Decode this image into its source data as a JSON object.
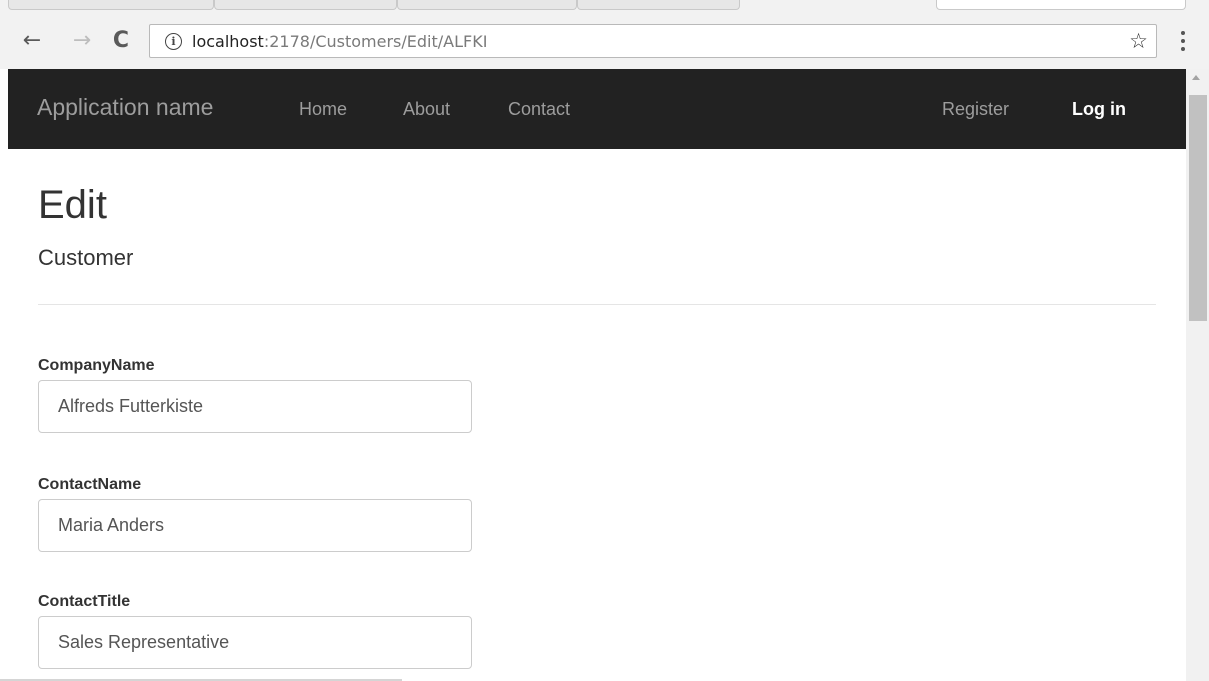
{
  "browser": {
    "url_host": "localhost",
    "url_path": ":2178/Customers/Edit/ALFKI",
    "back_icon": "←",
    "forward_icon": "→",
    "reload_icon": "C",
    "info_icon": "i",
    "star_icon": "☆"
  },
  "navbar": {
    "brand": "Application name",
    "links": [
      "Home",
      "About",
      "Contact"
    ],
    "register": "Register",
    "login": "Log in"
  },
  "page": {
    "title": "Edit",
    "subtitle": "Customer"
  },
  "form": {
    "fields": [
      {
        "label": "CompanyName",
        "value": "Alfreds Futterkiste"
      },
      {
        "label": "ContactName",
        "value": "Maria Anders"
      },
      {
        "label": "ContactTitle",
        "value": "Sales Representative"
      }
    ]
  },
  "scrollbar": {
    "position_fraction": 0.0
  }
}
